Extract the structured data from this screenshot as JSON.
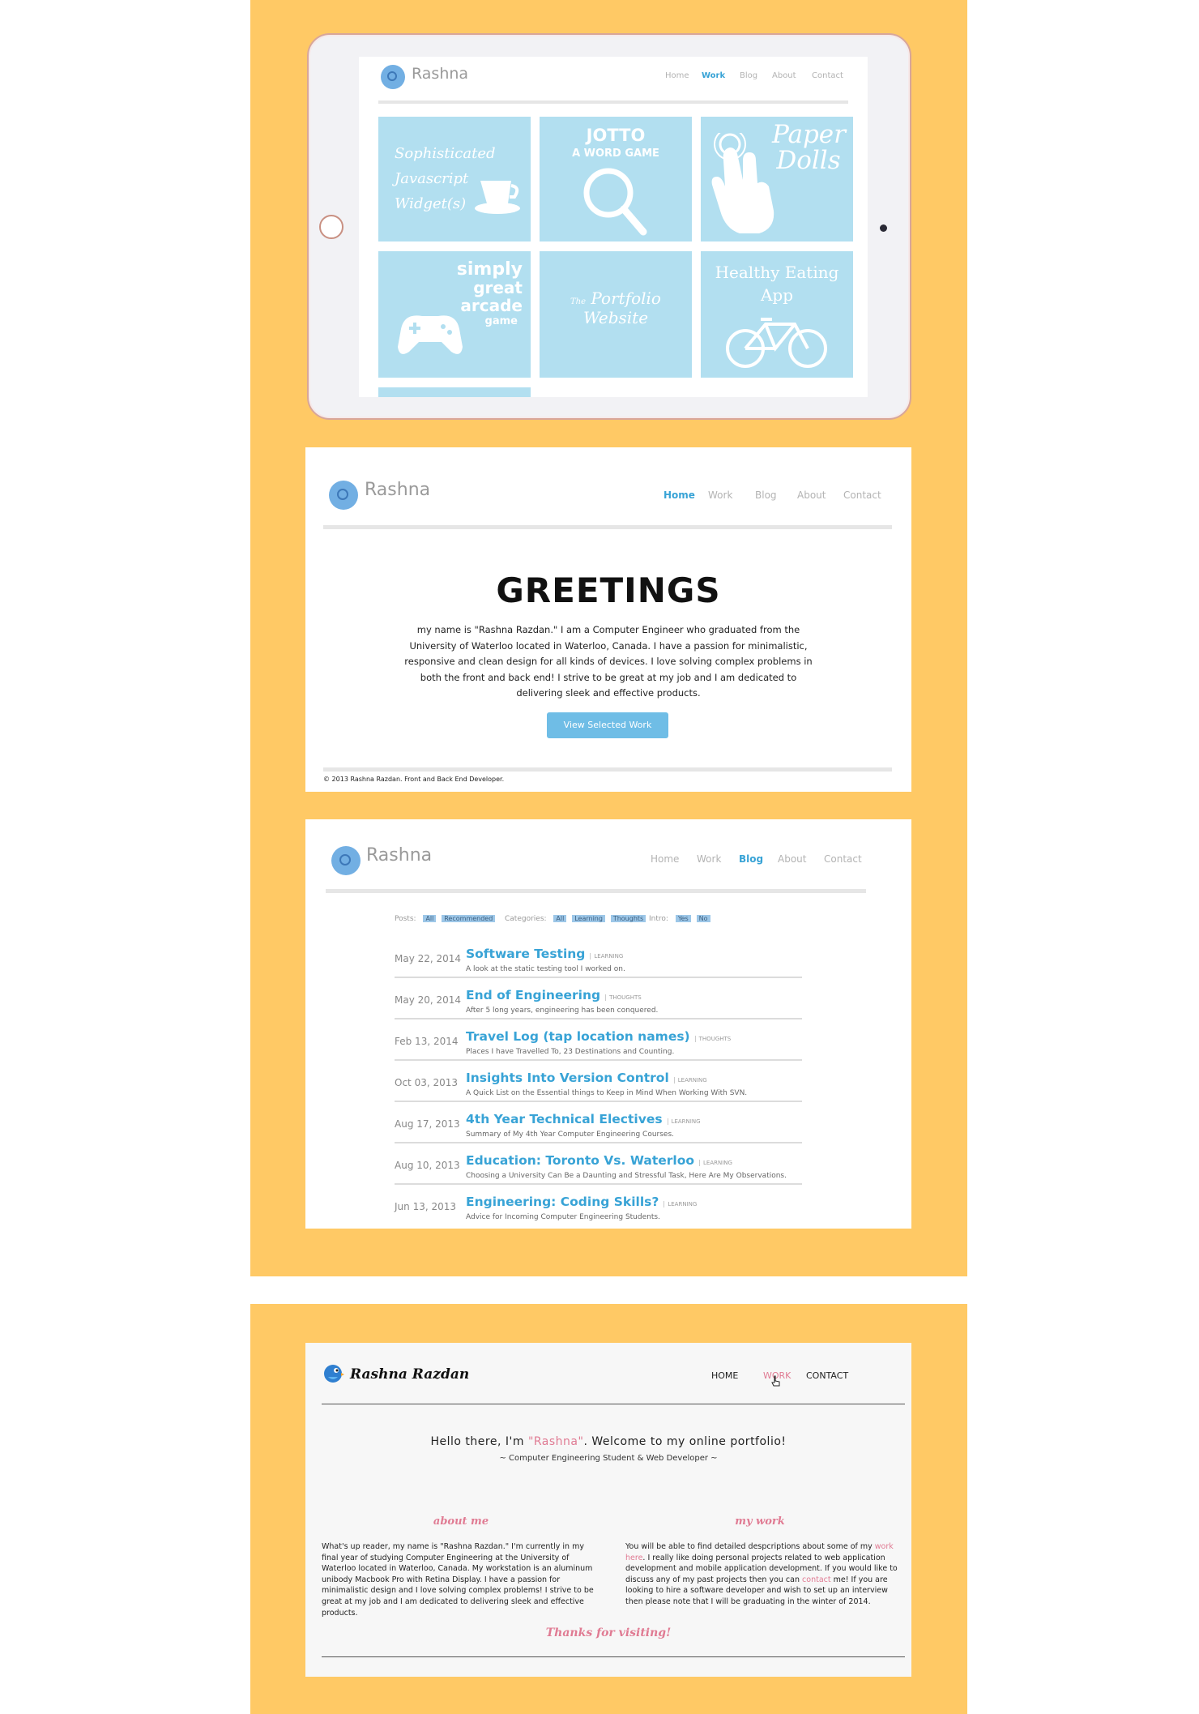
{
  "tablet": {
    "brand": "Rashna",
    "nav": [
      "Home",
      "Work",
      "Blog",
      "About",
      "Contact"
    ],
    "active_nav": "Work",
    "tiles": [
      {
        "label": "Sophisticated Javascript Widget(s)",
        "icon": "coffee-cup-icon"
      },
      {
        "label_line1": "JOTTO",
        "label_line2": "A WORD GAME",
        "icon": "magnifier-icon"
      },
      {
        "label": "Paper Dolls",
        "icon": "hand-pointer-icon"
      },
      {
        "label_line1": "simply",
        "label_line2": "great",
        "label_line3": "arcade",
        "label_line4": "game",
        "icon": "gamepad-icon"
      },
      {
        "label_prefix": "The",
        "label": "Portfolio Website"
      },
      {
        "label_line1": "Healthy Eating",
        "label_line2": "App",
        "icon": "bicycle-icon"
      }
    ]
  },
  "home": {
    "brand": "Rashna",
    "nav": [
      "Home",
      "Work",
      "Blog",
      "About",
      "Contact"
    ],
    "active_nav": "Home",
    "heading": "GREETINGS",
    "intro": "my name is \"Rashna Razdan.\" I am a Computer Engineer who graduated from the University of Waterloo located in Waterloo, Canada. I have a passion for minimalistic, responsive and clean design for all kinds of devices. I love solving complex problems in both the front and back end! I strive to be great at my job and I am dedicated to delivering sleek and effective products.",
    "cta": "View Selected Work",
    "footer": "© 2013 Rashna Razdan. Front and Back End Developer."
  },
  "blog": {
    "brand": "Rashna",
    "nav": [
      "Home",
      "Work",
      "Blog",
      "About",
      "Contact"
    ],
    "active_nav": "Blog",
    "filters": {
      "posts_label": "Posts:",
      "posts": [
        "All",
        "Recommended"
      ],
      "categories_label": "Categories:",
      "categories": [
        "All",
        "Learning",
        "Thoughts"
      ],
      "intro_label": "Intro:",
      "intro": [
        "Yes",
        "No"
      ]
    },
    "posts": [
      {
        "date": "May 22, 2014",
        "title": "Software Testing",
        "tag": "LEARNING",
        "desc": "A look at the static testing tool I worked on."
      },
      {
        "date": "May 20, 2014",
        "title": "End of Engineering",
        "tag": "THOUGHTS",
        "desc": "After 5 long years, engineering has been conquered."
      },
      {
        "date": "Feb 13, 2014",
        "title": "Travel Log (tap location names)",
        "tag": "THOUGHTS",
        "desc": "Places I have Travelled To, 23 Destinations and Counting."
      },
      {
        "date": "Oct 03, 2013",
        "title": "Insights Into Version Control",
        "tag": "LEARNING",
        "desc": "A Quick List on the Essential things to Keep in Mind When Working With SVN."
      },
      {
        "date": "Aug 17, 2013",
        "title": "4th Year Technical Electives",
        "tag": "LEARNING",
        "desc": "Summary of My 4th Year Computer Engineering Courses."
      },
      {
        "date": "Aug 10, 2013",
        "title": "Education: Toronto Vs. Waterloo",
        "tag": "LEARNING",
        "desc": "Choosing a University Can Be a Daunting and Stressful Task, Here Are My Observations."
      },
      {
        "date": "Jun 13, 2013",
        "title": "Engineering: Coding Skills?",
        "tag": "LEARNING",
        "desc": "Advice for Incoming Computer Engineering Students."
      }
    ]
  },
  "old_site": {
    "brand": "Rashna Razdan",
    "nav": [
      "HOME",
      "WORK",
      "CONTACT"
    ],
    "hovered_nav": "WORK",
    "hello_prefix": "Hello there, I'm ",
    "hello_name": "\"Rashna\"",
    "hello_suffix": ". Welcome to my online portfolio!",
    "subtitle": "~ Computer Engineering Student & Web Developer ~",
    "about_heading": "about me",
    "about_text": "What's up reader, my name is \"Rashna Razdan.\" I'm currently in my final year of studying Computer Engineering at the University of Waterloo located in Waterloo, Canada. My workstation is an aluminum unibody Macbook Pro with Retina Display. I have a passion for minimalistic design and I love solving complex problems! I strive to be great at my job and I am dedicated to delivering sleek and effective products.",
    "work_heading": "my work",
    "work_text_1": "You will be able to find detailed despcriptions about some of my ",
    "work_link_1": "work here",
    "work_text_2": ". I really like doing personal projects related to web application development and mobile application development. If you would like to discuss any of my past projects then you can ",
    "work_link_2": "contact",
    "work_text_3": " me! If you are looking to hire a software developer and wish to set up an interview then please note that I will be graduating in the winter of 2014.",
    "thanks": "Thanks for visiting!"
  },
  "colors": {
    "background_panel": "#ffc965",
    "accent_blue": "#38a3d6",
    "tile_blue": "#b2dff0",
    "pink": "#e07b93"
  }
}
